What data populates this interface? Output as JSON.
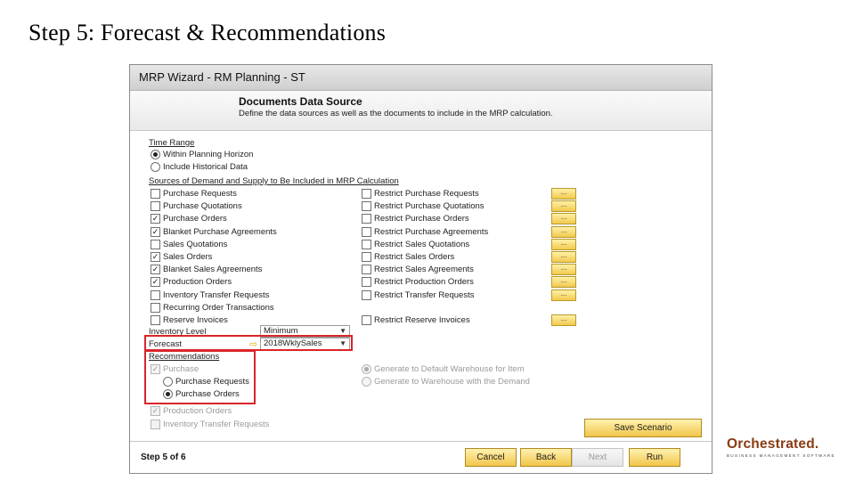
{
  "slide": {
    "title": "Step 5: Forecast & Recommendations"
  },
  "window": {
    "title": "MRP Wizard - RM Planning - ST",
    "header_title": "Documents Data Source",
    "header_desc": "Define the data sources as well as the documents to include in the MRP calculation."
  },
  "time_range": {
    "label": "Time Range",
    "options": [
      {
        "label": "Within Planning Horizon",
        "selected": true
      },
      {
        "label": "Include Historical Data",
        "selected": false
      }
    ]
  },
  "sources": {
    "label": "Sources of Demand and Supply to Be Included in MRP Calculation",
    "left": [
      {
        "label": "Purchase Requests",
        "checked": false
      },
      {
        "label": "Purchase Quotations",
        "checked": false
      },
      {
        "label": "Purchase Orders",
        "checked": true
      },
      {
        "label": "Blanket Purchase Agreements",
        "checked": true
      },
      {
        "label": "Sales Quotations",
        "checked": false
      },
      {
        "label": "Sales Orders",
        "checked": true
      },
      {
        "label": "Blanket Sales Agreements",
        "checked": true
      },
      {
        "label": "Production Orders",
        "checked": true
      },
      {
        "label": "Inventory Transfer Requests",
        "checked": false
      },
      {
        "label": "Recurring Order Transactions",
        "checked": false
      },
      {
        "label": "Reserve Invoices",
        "checked": false
      }
    ],
    "right": [
      {
        "label": "Restrict Purchase Requests",
        "checked": false
      },
      {
        "label": "Restrict Purchase Quotations",
        "checked": false
      },
      {
        "label": "Restrict Purchase Orders",
        "checked": false
      },
      {
        "label": "Restrict Purchase Agreements",
        "checked": false
      },
      {
        "label": "Restrict Sales Quotations",
        "checked": false
      },
      {
        "label": "Restrict Sales Orders",
        "checked": false
      },
      {
        "label": "Restrict Sales Agreements",
        "checked": false
      },
      {
        "label": "Restrict Production Orders",
        "checked": false
      },
      {
        "label": "Restrict Transfer Requests",
        "checked": false
      },
      {
        "label": "Restrict Reserve Invoices",
        "checked": false
      }
    ],
    "dots_label": "..."
  },
  "inventory_level": {
    "label": "Inventory Level",
    "value": "Minimum"
  },
  "forecast": {
    "label": "Forecast",
    "value": "2018WklySales"
  },
  "recommendations": {
    "label": "Recommendations",
    "purchase": {
      "label": "Purchase",
      "checked": true,
      "disabled": true
    },
    "purchase_requests": {
      "label": "Purchase Requests",
      "selected": false
    },
    "purchase_orders": {
      "label": "Purchase Orders",
      "selected": true
    },
    "warehouse_default": {
      "label": "Generate to Default Warehouse for Item",
      "selected": true
    },
    "warehouse_demand": {
      "label": "Generate to Warehouse with the Demand",
      "selected": false
    },
    "production_orders": {
      "label": "Production Orders",
      "checked": true
    },
    "inventory_transfer": {
      "label": "Inventory Transfer Requests",
      "checked": false
    }
  },
  "buttons": {
    "save_scenario": "Save Scenario",
    "cancel": "Cancel",
    "back": "Back",
    "next": "Next",
    "run": "Run"
  },
  "step_text": "Step 5 of 6",
  "logo": {
    "name": "Orchestrated.",
    "tagline": "BUSINESS MANAGEMENT SOFTWARE"
  },
  "colors": {
    "highlight": "#d9252a",
    "button": "#f2c94c",
    "logo": "#8a3b12"
  },
  "icons": {
    "pointer": "hand-pointer-icon"
  }
}
